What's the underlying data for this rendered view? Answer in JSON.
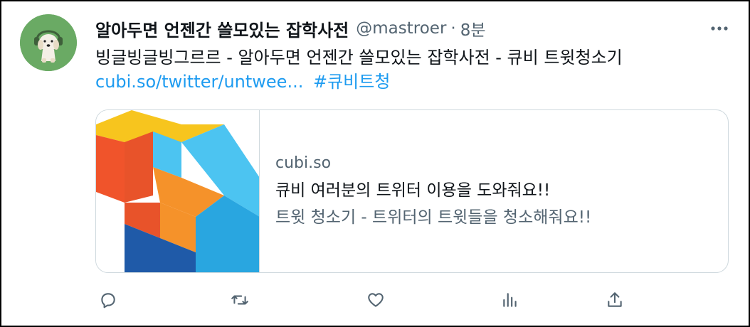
{
  "tweet": {
    "author_name": "알아두면 언젠간 쓸모있는 잡학사전",
    "handle": "@mastroer",
    "separator": "·",
    "time": "8분",
    "text": "빙글빙글빙그르르 - 알아두면 언젠간 쓸모있는 잡학사전 - 큐비 트윗청소기",
    "url_text": "cubi.so/twitter/untwee...",
    "hashtag": "#큐비트청"
  },
  "card": {
    "domain": "cubi.so",
    "title": "큐비 여러분의 트위터 이용을 도와줘요!!",
    "description": "트윗 청소기 - 트위터의 트윗들을 청소해줘요!!"
  },
  "icons": {
    "more": "more-horizontal-icon",
    "reply": "reply-icon",
    "retweet": "retweet-icon",
    "like": "like-icon",
    "views": "views-icon",
    "share": "share-icon"
  },
  "colors": {
    "link": "#1d9bf0",
    "secondary_text": "#536471",
    "avatar_bg": "#6aaa64"
  }
}
